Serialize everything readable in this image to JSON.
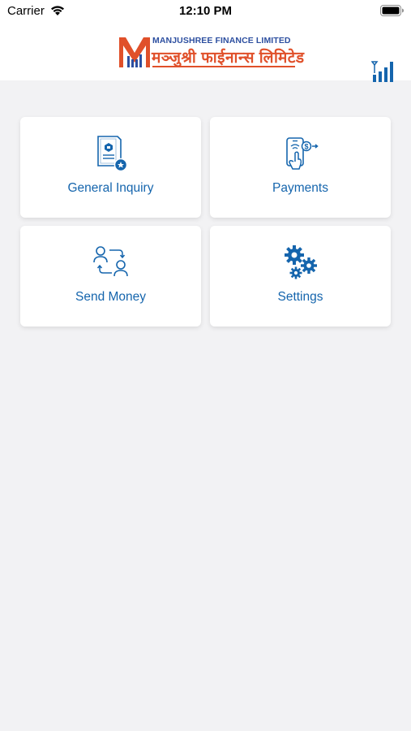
{
  "status_bar": {
    "carrier": "Carrier",
    "time": "12:10 PM"
  },
  "header": {
    "logo_text_en": "MANJUSHREE FINANCE LIMITED",
    "logo_text_ne": "मञ्जुश्री फाईनान्स लिमिटेड",
    "brand_blue": "#2d4fa0",
    "brand_orange": "#e0502a"
  },
  "menu": {
    "items": [
      {
        "label": "General Inquiry",
        "icon": "document-inquiry-icon"
      },
      {
        "label": "Payments",
        "icon": "mobile-payment-icon"
      },
      {
        "label": "Send Money",
        "icon": "transfer-users-icon"
      },
      {
        "label": "Settings",
        "icon": "gears-icon"
      }
    ],
    "accent": "#1565ad"
  }
}
